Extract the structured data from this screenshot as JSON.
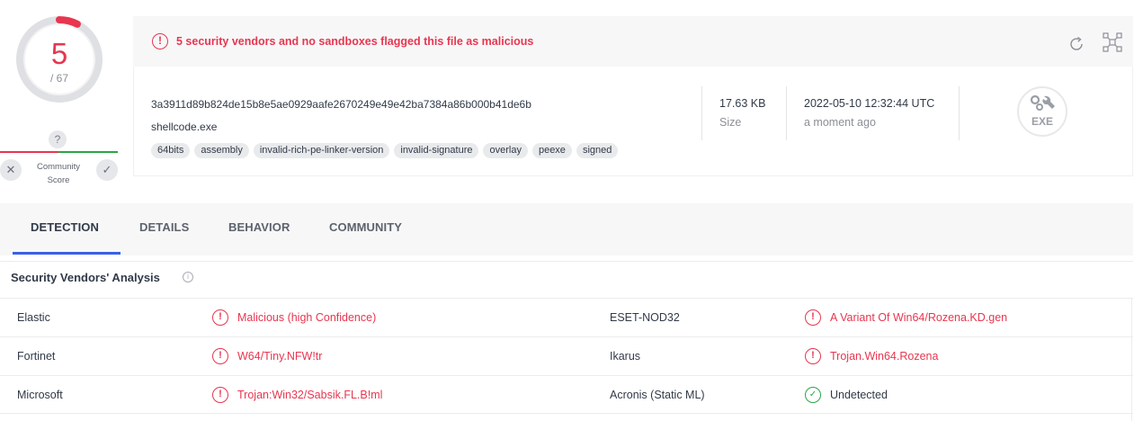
{
  "score": {
    "detected": "5",
    "total": "/ 67",
    "ring_fraction": 0.075,
    "colors": {
      "ring": "#e8364f",
      "track": "#dfe0e3"
    }
  },
  "community": {
    "question": "?",
    "label": "Community Score",
    "down_icon": "close-icon",
    "up_icon": "check-icon"
  },
  "banner": {
    "alert_icon": "!",
    "text": "5 security vendors and no sandboxes flagged this file as malicious",
    "accent": "#e8364f"
  },
  "file": {
    "hash": "3a3911d89b824de15b8e5ae0929aafe2670249e49e42ba7384a86b000b41de6b",
    "name": "shellcode.exe",
    "tags": [
      "64bits",
      "assembly",
      "invalid-rich-pe-linker-version",
      "invalid-signature",
      "overlay",
      "peexe",
      "signed"
    ],
    "size_value": "17.63 KB",
    "size_label": "Size",
    "date_value": "2022-05-10 12:32:44 UTC",
    "date_label": "a moment ago",
    "type_badge": "EXE"
  },
  "tabs": [
    {
      "label": "DETECTION",
      "active": true
    },
    {
      "label": "DETAILS",
      "active": false
    },
    {
      "label": "BEHAVIOR",
      "active": false
    },
    {
      "label": "COMMUNITY",
      "active": false
    }
  ],
  "section": {
    "title": "Security Vendors' Analysis",
    "info_icon": "i"
  },
  "vendors": [
    {
      "left": {
        "name": "Elastic",
        "result": "Malicious (high Confidence)",
        "status": "malicious"
      },
      "right": {
        "name": "ESET-NOD32",
        "result": "A Variant Of Win64/Rozena.KD.gen",
        "status": "malicious"
      }
    },
    {
      "left": {
        "name": "Fortinet",
        "result": "W64/Tiny.NFW!tr",
        "status": "malicious"
      },
      "right": {
        "name": "Ikarus",
        "result": "Trojan.Win64.Rozena",
        "status": "malicious"
      }
    },
    {
      "left": {
        "name": "Microsoft",
        "result": "Trojan:Win32/Sabsik.FL.B!ml",
        "status": "malicious"
      },
      "right": {
        "name": "Acronis (Static ML)",
        "result": "Undetected",
        "status": "undetected"
      }
    }
  ],
  "status_icons": {
    "malicious": "!",
    "undetected": "✓"
  }
}
